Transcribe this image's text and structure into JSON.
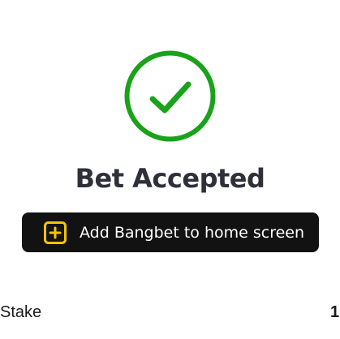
{
  "status": {
    "icon": "check-circle-icon",
    "title": "Bet Accepted",
    "color": "#1aa21a"
  },
  "home_button": {
    "icon": "plus-square-icon",
    "label": "Add Bangbet to home screen",
    "background": "#121212",
    "icon_color": "#f5c400"
  },
  "summary": {
    "stake_label": "Stake",
    "stake_value": "1"
  }
}
